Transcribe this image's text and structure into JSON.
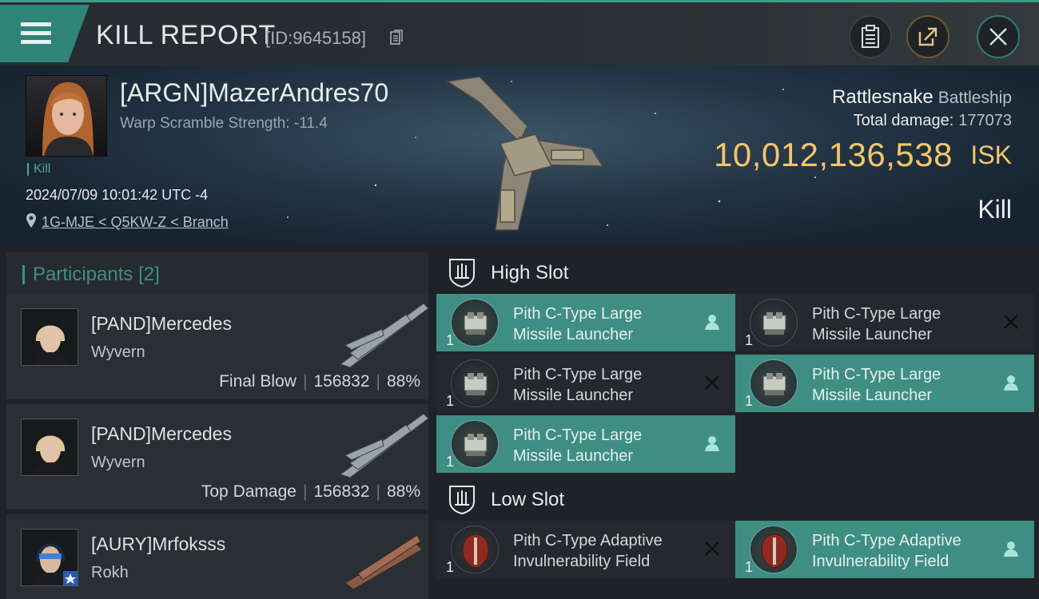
{
  "header": {
    "title": "KILL REPORT",
    "kill_id": "[ID:9645158]"
  },
  "victim": {
    "name": "[ARGN]MazerAndres70",
    "warp_scramble": "Warp Scramble Strength: -11.4",
    "tag": "Kill",
    "timestamp": "2024/07/09 10:01:42 UTC -4",
    "location": "1G-MJE < Q5KW-Z < Branch",
    "ship_name": "Rattlesnake",
    "ship_class": "Battleship",
    "total_damage_label": "Total damage:",
    "total_damage": "177073",
    "isk_value": "10,012,136,538",
    "isk_unit": "ISK",
    "kill_type": "Kill"
  },
  "participants": {
    "title": "Participants",
    "count": "[2]",
    "items": [
      {
        "name": "[PAND]Mercedes",
        "ship": "Wyvern",
        "role": "Final Blow",
        "damage": "156832",
        "percent": "88%"
      },
      {
        "name": "[PAND]Mercedes",
        "ship": "Wyvern",
        "role": "Top Damage",
        "damage": "156832",
        "percent": "88%"
      },
      {
        "name": "[AURY]Mrfoksss",
        "ship": "Rokh",
        "role": "",
        "damage": "",
        "percent": ""
      }
    ]
  },
  "slots": {
    "high": {
      "label": "High Slot",
      "modules": [
        {
          "name_line1": "Pith C-Type Large",
          "name_line2": "Missile Launcher",
          "qty": "1",
          "status": "survived"
        },
        {
          "name_line1": "Pith C-Type Large",
          "name_line2": "Missile Launcher",
          "qty": "1",
          "status": "destroyed"
        },
        {
          "name_line1": "Pith C-Type Large",
          "name_line2": "Missile Launcher",
          "qty": "1",
          "status": "destroyed"
        },
        {
          "name_line1": "Pith C-Type Large",
          "name_line2": "Missile Launcher",
          "qty": "1",
          "status": "survived"
        },
        {
          "name_line1": "Pith C-Type Large",
          "name_line2": "Missile Launcher",
          "qty": "1",
          "status": "survived"
        }
      ]
    },
    "low": {
      "label": "Low Slot",
      "modules": [
        {
          "name_line1": "Pith C-Type Adaptive",
          "name_line2": "Invulnerability Field",
          "qty": "1",
          "status": "destroyed"
        },
        {
          "name_line1": "Pith C-Type Adaptive",
          "name_line2": "Invulnerability Field",
          "qty": "1",
          "status": "survived"
        }
      ]
    }
  },
  "colors": {
    "accent": "#3f8e84",
    "isk": "#f2c66a"
  }
}
